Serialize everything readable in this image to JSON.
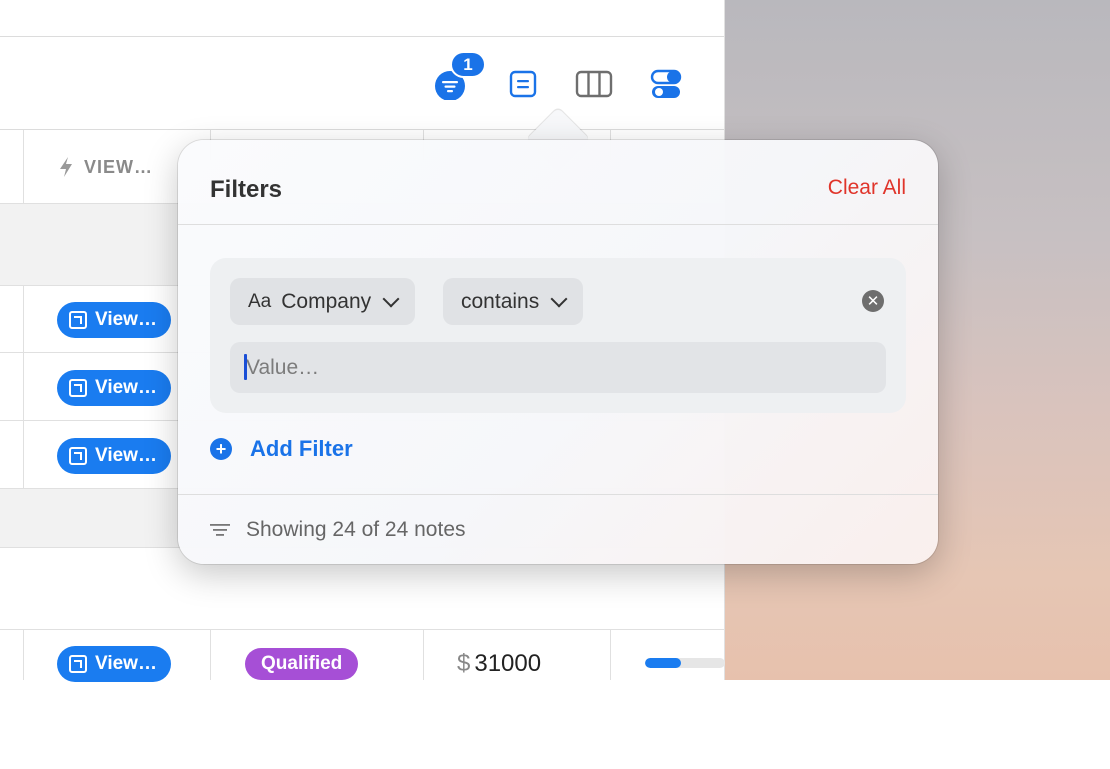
{
  "toolbar": {
    "filter_badge": "1",
    "icons": [
      "filter-icon",
      "note-icon",
      "columns-icon",
      "toggles-icon"
    ]
  },
  "table": {
    "header_view": "VIEW…",
    "view_button_label": "View…",
    "last_row": {
      "status": "Qualified",
      "currency": "$",
      "amount": "31000",
      "progress": 0.45
    }
  },
  "filters_popover": {
    "title": "Filters",
    "clear_all": "Clear All",
    "field_type_glyph": "Aa",
    "field": "Company",
    "operator": "contains",
    "value_placeholder": "Value…",
    "value": "",
    "add_filter": "Add Filter",
    "footer_text": "Showing 24 of 24 notes"
  },
  "colors": {
    "accent": "#1a73e8",
    "clear_all": "#e0342a",
    "qualified": "#a64fd6"
  }
}
